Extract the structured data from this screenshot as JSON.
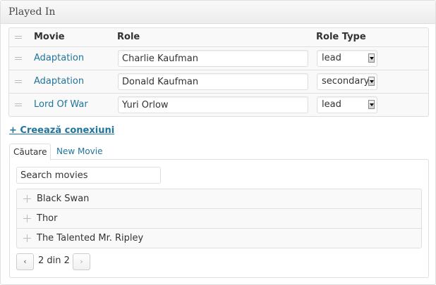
{
  "metabox": {
    "title": "Played In"
  },
  "table": {
    "headers": {
      "movie": "Movie",
      "role": "Role",
      "role_type": "Role Type"
    },
    "rows": [
      {
        "movie": "Adaptation",
        "role": "Charlie Kaufman",
        "role_type": "lead"
      },
      {
        "movie": "Adaptation",
        "role": "Donald Kaufman",
        "role_type": "secondary"
      },
      {
        "movie": "Lord Of War",
        "role": "Yuri Orlow",
        "role_type": "lead"
      }
    ]
  },
  "create_link": "+ Creează conexiuni",
  "tabs": [
    {
      "label": "Căutare",
      "active": true
    },
    {
      "label": "New Movie",
      "active": false
    }
  ],
  "search": {
    "value": "Search movies"
  },
  "results": [
    "Black Swan",
    "Thor",
    "The Talented Mr. Ripley"
  ],
  "pager": {
    "prev": "‹",
    "next": "›",
    "info": "2 din 2"
  },
  "colors": {
    "link": "#21759b",
    "border": "#dfdfdf",
    "row_bg": "#f9f9f9"
  },
  "icons": {
    "drag": "drag-handle-icon",
    "add": "plus-icon",
    "dropdown": "chevron-down-icon"
  }
}
